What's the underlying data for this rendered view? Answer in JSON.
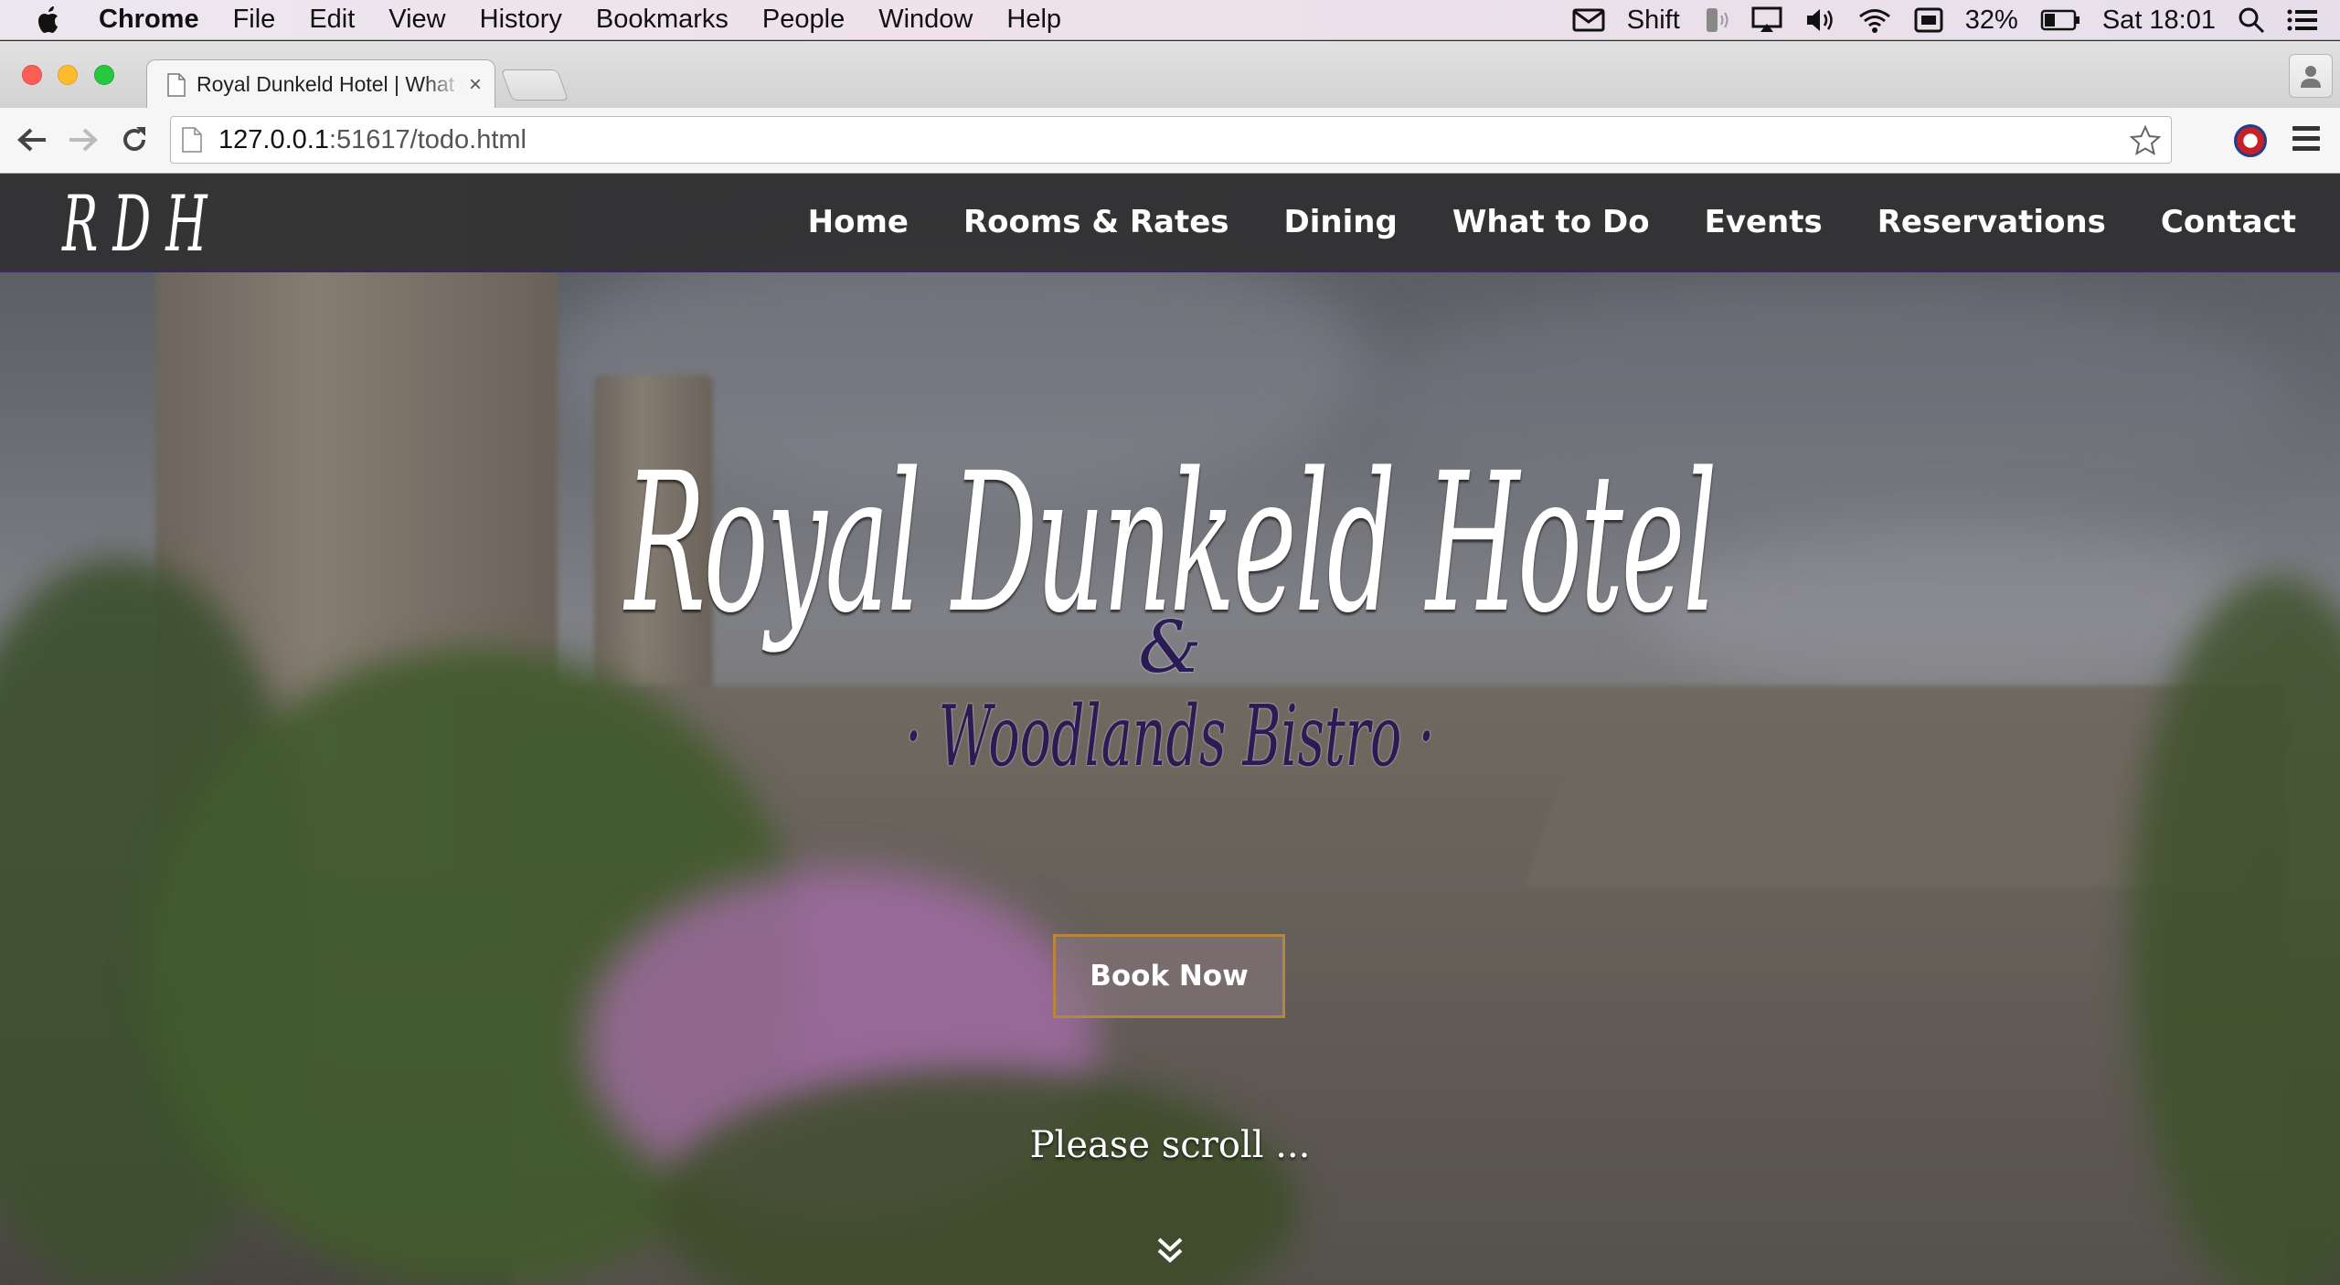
{
  "menubar": {
    "app": "Chrome",
    "items": [
      "File",
      "Edit",
      "View",
      "History",
      "Bookmarks",
      "People",
      "Window",
      "Help"
    ],
    "status": {
      "shift": "Shift",
      "battery": "32%",
      "clock": "Sat 18:01"
    }
  },
  "browser": {
    "tab_title": "Royal Dunkeld Hotel | What to Do",
    "tab_close": "×",
    "url_host": "127.0.0.1",
    "url_rest": ":51617/todo.html"
  },
  "site": {
    "logo": "RDH",
    "nav": [
      "Home",
      "Rooms & Rates",
      "Dining",
      "What to Do",
      "Events",
      "Reservations",
      "Contact"
    ],
    "hero_title": "Royal Dunkeld Hotel",
    "hero_amp": "&",
    "hero_sub": "· Woodlands Bistro ·",
    "book_label": "Book Now",
    "scroll_text": "Please scroll ..."
  },
  "colors": {
    "nav_accent": "#3b2663",
    "button_border": "#b8863a",
    "subtitle": "#2b1b55"
  }
}
